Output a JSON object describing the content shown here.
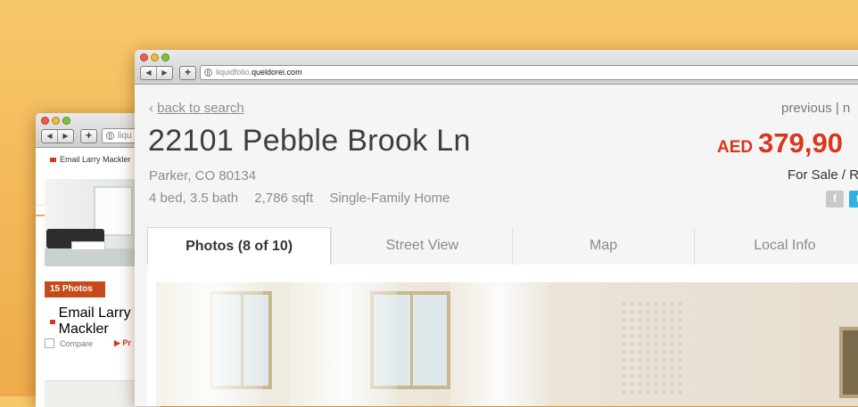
{
  "back_window": {
    "url_domain": "liqu",
    "email_label": "Email Larry Mackler",
    "photos_badge": "15 Photos",
    "email_label_2": "Email Larry Mackler",
    "compare_label": "Compare",
    "more_label": "Pr"
  },
  "front_window": {
    "url_domain": "liquidfolio.",
    "url_host": "queldorei.com",
    "back_link": "back to search",
    "prev_next": "previous  |  n",
    "address": "22101 Pebble Brook Ln",
    "city": "Parker, CO 80134",
    "details": [
      "4 bed, 3.5 bath",
      "2,786 sqft",
      "Single-Family Home"
    ],
    "currency": "AED",
    "price": "379,90",
    "status": "For Sale / R",
    "social": {
      "facebook": "f",
      "twitter": "t"
    },
    "tabs": [
      {
        "label": "Photos (8 of 10)",
        "active": true
      },
      {
        "label": "Street View",
        "active": false
      },
      {
        "label": "Map",
        "active": false
      },
      {
        "label": "Local Info",
        "active": false
      }
    ]
  },
  "colors": {
    "accent": "#d9361c",
    "background": "#f3b757"
  }
}
